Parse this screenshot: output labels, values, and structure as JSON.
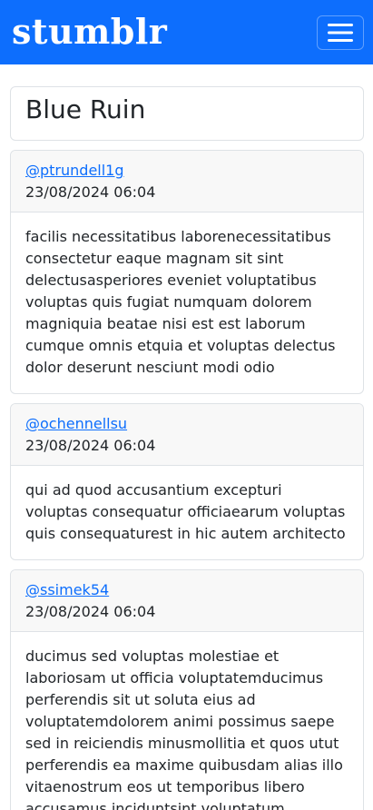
{
  "app": {
    "brand": "stumblr"
  },
  "page": {
    "title": "Blue Ruin"
  },
  "posts": [
    {
      "user": "@ptrundell1g",
      "timestamp": "23/08/2024 06:04",
      "body": "facilis necessitatibus laborenecessitatibus consectetur eaque magnam sit sint delectusasperiores eveniet voluptatibus voluptas quis fugiat numquam dolorem magniquia beatae nisi est est laborum cumque omnis etquia et voluptas delectus dolor deserunt nesciunt modi odio"
    },
    {
      "user": "@ochennellsu",
      "timestamp": "23/08/2024 06:04",
      "body": "qui ad quod accusantium excepturi voluptas consequatur officiaearum voluptas quis consequaturest in hic autem architecto"
    },
    {
      "user": "@ssimek54",
      "timestamp": "23/08/2024 06:04",
      "body": "ducimus sed voluptas molestiae et laboriosam ut officia voluptatemducimus perferendis sit ut soluta eius ad voluptatemdolorem animi possimus saepe sed in reiciendis minusmollitia et quos utut perferendis ea maxime quibusdam alias illo vitaenostrum eos ut temporibus libero accusamus inciduntsint voluptatum"
    }
  ],
  "colors": {
    "navbar": "#0d6efd",
    "link": "#0d6efd"
  },
  "icons": {
    "menu": "hamburger-menu-icon"
  }
}
